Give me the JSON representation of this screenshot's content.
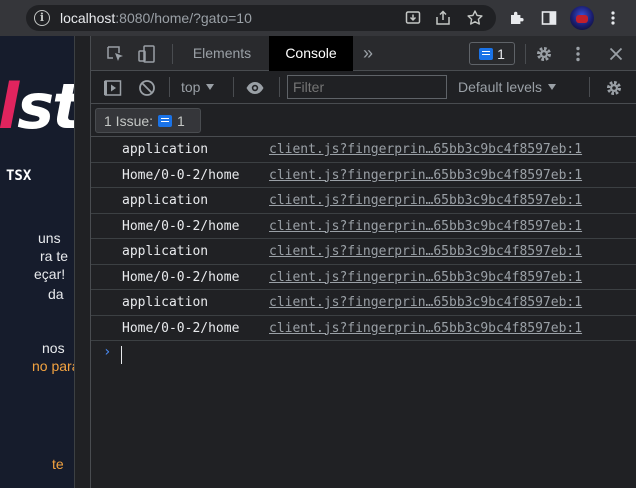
{
  "browser": {
    "url_host": "localhost",
    "url_rest": ":8080/home/?gato=10"
  },
  "page": {
    "logo_accent": "l",
    "logo_rest": "st",
    "tsx": "TSX",
    "lines": [
      "uns",
      "ra te",
      "eçar!",
      "da",
      "nos",
      "no para",
      "te"
    ]
  },
  "devtools": {
    "tabs": [
      {
        "label": "Elements"
      },
      {
        "label": "Console"
      }
    ],
    "more_tabs": "»",
    "issues_count": "1",
    "toolbar": {
      "context": "top",
      "filter_placeholder": "Filter",
      "levels": "Default levels"
    },
    "issues_label": "1 Issue:",
    "issues_chip_count": "1"
  },
  "console": {
    "entries": [
      {
        "message": "application",
        "source": "client.js?fingerprin…65bb3c9bc4f8597eb:1"
      },
      {
        "message": "Home/0-0-2/home",
        "source": "client.js?fingerprin…65bb3c9bc4f8597eb:1"
      },
      {
        "message": "application",
        "source": "client.js?fingerprin…65bb3c9bc4f8597eb:1"
      },
      {
        "message": "Home/0-0-2/home",
        "source": "client.js?fingerprin…65bb3c9bc4f8597eb:1"
      },
      {
        "message": "application",
        "source": "client.js?fingerprin…65bb3c9bc4f8597eb:1"
      },
      {
        "message": "Home/0-0-2/home",
        "source": "client.js?fingerprin…65bb3c9bc4f8597eb:1"
      },
      {
        "message": "application",
        "source": "client.js?fingerprin…65bb3c9bc4f8597eb:1"
      },
      {
        "message": "Home/0-0-2/home",
        "source": "client.js?fingerprin…65bb3c9bc4f8597eb:1"
      }
    ],
    "prompt": "›"
  },
  "colors": {
    "accent_blue": "#1a73e8",
    "logo_pink": "#e0245e",
    "page_orange": "#f4a340"
  }
}
